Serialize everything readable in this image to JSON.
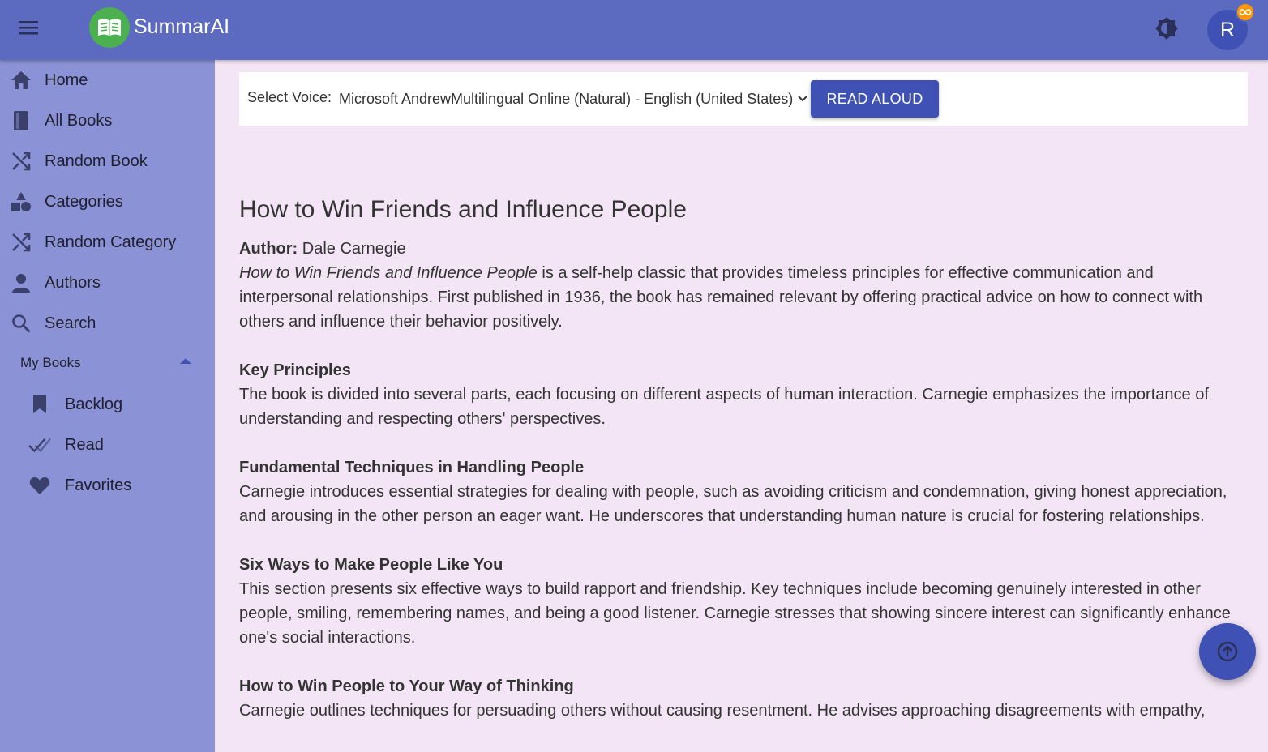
{
  "app": {
    "title": "SummarAI",
    "avatar_initial": "R",
    "colors": {
      "appbar": "#5c6bc0",
      "sidebar": "#8b92d6",
      "content_bg": "#f3e5f5",
      "primary": "#3f51b5",
      "badge": "#ff9800",
      "logo": "#4caf50"
    }
  },
  "header": {
    "menu_icon": "menu-icon",
    "logo_icon": "open-book-icon",
    "theme_icon": "brightness-icon",
    "badge_icon": "infinity-icon"
  },
  "sidebar": {
    "items": [
      {
        "label": "Home",
        "icon": "home-icon"
      },
      {
        "label": "All Books",
        "icon": "book-icon"
      },
      {
        "label": "Random Book",
        "icon": "shuffle-icon"
      },
      {
        "label": "Categories",
        "icon": "category-icon"
      },
      {
        "label": "Random Category",
        "icon": "shuffle-icon"
      },
      {
        "label": "Authors",
        "icon": "person-icon"
      },
      {
        "label": "Search",
        "icon": "search-icon"
      }
    ],
    "my_books": {
      "label": "My Books",
      "expanded": true,
      "items": [
        {
          "label": "Backlog",
          "icon": "bookmark-icon"
        },
        {
          "label": "Read",
          "icon": "double-check-icon"
        },
        {
          "label": "Favorites",
          "icon": "heart-icon"
        }
      ]
    }
  },
  "voice": {
    "label": "Select Voice:",
    "selected": "Microsoft AndrewMultilingual Online (Natural) - English (United States)",
    "button": "READ ALOUD"
  },
  "book": {
    "title": "How to Win Friends and Influence People",
    "author_label": "Author:",
    "author": "Dale Carnegie",
    "intro_title": "How to Win Friends and Influence People",
    "intro_rest": " is a self-help classic that provides timeless principles for effective communication and interpersonal relationships. First published in 1936, the book has remained relevant by offering practical advice on how to connect with others and influence their behavior positively.",
    "sections": [
      {
        "title": "Key Principles",
        "body": "The book is divided into several parts, each focusing on different aspects of human interaction. Carnegie emphasizes the importance of understanding and respecting others' perspectives."
      },
      {
        "title": "Fundamental Techniques in Handling People",
        "body": "Carnegie introduces essential strategies for dealing with people, such as avoiding criticism and condemnation, giving honest appreciation, and arousing in the other person an eager want. He underscores that understanding human nature is crucial for fostering relationships."
      },
      {
        "title": "Six Ways to Make People Like You",
        "body": "This section presents six effective ways to build rapport and friendship. Key techniques include becoming genuinely interested in other people, smiling, remembering names, and being a good listener. Carnegie stresses that showing sincere interest can significantly enhance one's social interactions."
      },
      {
        "title": "How to Win People to Your Way of Thinking",
        "body": "Carnegie outlines techniques for persuading others without causing resentment. He advises approaching disagreements with empathy,"
      }
    ]
  },
  "fab": {
    "icon": "arrow-up-circle-icon"
  }
}
